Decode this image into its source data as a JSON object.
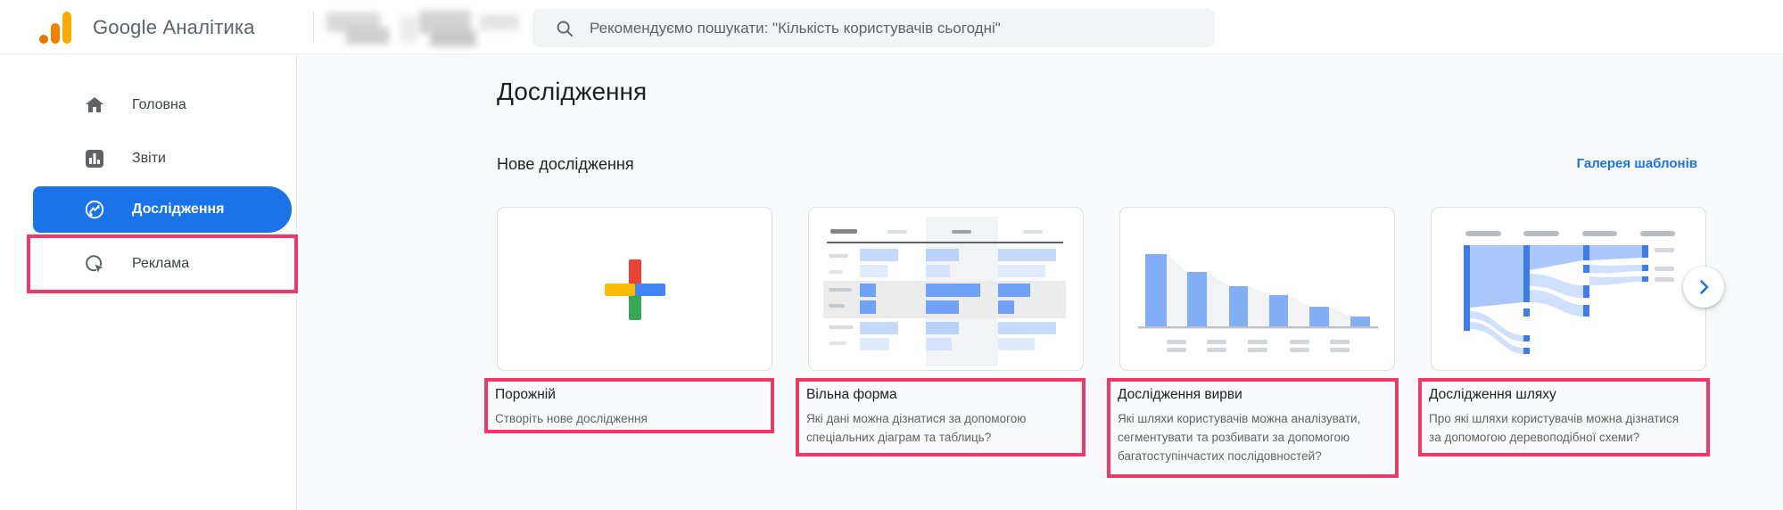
{
  "header": {
    "app_title": "Google Аналітика",
    "search_placeholder": "Рекомендуємо пошукати: \"Кількість користувачів сьогодні\""
  },
  "sidebar": {
    "items": [
      {
        "label": "Головна",
        "icon": "home-icon",
        "selected": false
      },
      {
        "label": "Звіти",
        "icon": "reports-icon",
        "selected": false
      },
      {
        "label": "Дослідження",
        "icon": "explore-icon",
        "selected": true,
        "annotated": true
      },
      {
        "label": "Реклама",
        "icon": "ads-icon",
        "selected": false
      }
    ]
  },
  "main": {
    "page_title": "Дослідження",
    "section_title": "Нове дослідження",
    "gallery_link": "Галерея шаблонів",
    "cards": [
      {
        "title": "Порожній",
        "description": "Створіть нове дослідження",
        "thumbnail": "blank-plus",
        "annotated": true
      },
      {
        "title": "Вільна форма",
        "description": "Які дані можна дізнатися за допомогою спеціальних діаграм та таблиць?",
        "thumbnail": "free-form-table",
        "annotated": true
      },
      {
        "title": "Дослідження вирви",
        "description": "Які шляхи користувачів можна аналізувати, сегментувати та розбивати за допомогою багатоступінчастих послідовностей?",
        "thumbnail": "funnel-bars",
        "annotated": true
      },
      {
        "title": "Дослідження шляху",
        "description": "Про які шляхи користувачів можна дізнатися за допомогою деревоподібної схеми?",
        "thumbnail": "path-tree",
        "annotated": true
      }
    ],
    "next_button_icon": "chevron-right-icon"
  },
  "colors": {
    "accent_blue": "#1a73e8",
    "annotation_pink": "#f1386b",
    "content_bg": "#f8f9fa",
    "logo_orange": "#e37400",
    "logo_amber": "#f9ab00",
    "thumb_blue_medium": "#82aef5",
    "thumb_blue_dark": "#6fa2f7",
    "thumb_blue_light": "#c5dafb"
  }
}
